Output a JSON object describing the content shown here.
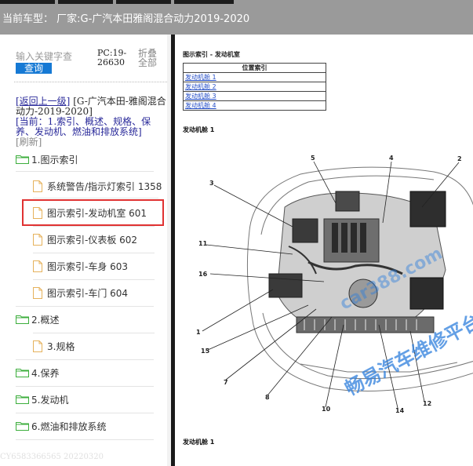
{
  "header": {
    "title": "当前车型：  厂家:G-广汽本田雅阁混合动力2019-2020"
  },
  "search": {
    "placeholder": "输入关键字查",
    "button_label": "查询",
    "pc_info": "PC:19-26630",
    "collapse_label": "折叠全部"
  },
  "nav": {
    "back_label": "[返回上一级]",
    "context": "[G-广汽本田-雅阁混合动力-2019-2020]",
    "current": "[当前：1.索引、概述、规格、保养、发动机、燃油和排放系统]",
    "refresh_label": "[刷新]"
  },
  "tree": [
    {
      "label": "1.图示索引"
    },
    {
      "label": "系统警告/指示灯索引 1358"
    },
    {
      "label": "图示索引-发动机室 601"
    },
    {
      "label": "图示索引-仪表板 602"
    },
    {
      "label": "图示索引-车身 603"
    },
    {
      "label": "图示索引-车门 604"
    },
    {
      "label": "2.概述"
    },
    {
      "label": "3.规格"
    },
    {
      "label": "4.保养"
    },
    {
      "label": "5.发动机"
    },
    {
      "label": "6.燃油和排放系统"
    }
  ],
  "footer": "CY6583366565 20220320",
  "content": {
    "section_title": "图示索引 - 发动机室",
    "table_header": "位置索引",
    "rows": [
      "发动机舱 1",
      "发动机舱 2",
      "发动机舱 3",
      "发动机舱 4"
    ],
    "figure_label": "发动机舱 1",
    "figure_label_bottom": "发动机舱 1",
    "callouts": [
      "5",
      "4",
      "2",
      "3",
      "11",
      "16",
      "1",
      "15",
      "7",
      "8",
      "10",
      "14",
      "12"
    ],
    "watermark_main": "畅易汽车维修平台",
    "watermark_url": "car388.com"
  },
  "colors": {
    "accent": "#1679d4",
    "highlight": "#e03232",
    "folder": "#3cae3c",
    "doc": "#e6b25c",
    "watermark": "#2f7fdc"
  }
}
